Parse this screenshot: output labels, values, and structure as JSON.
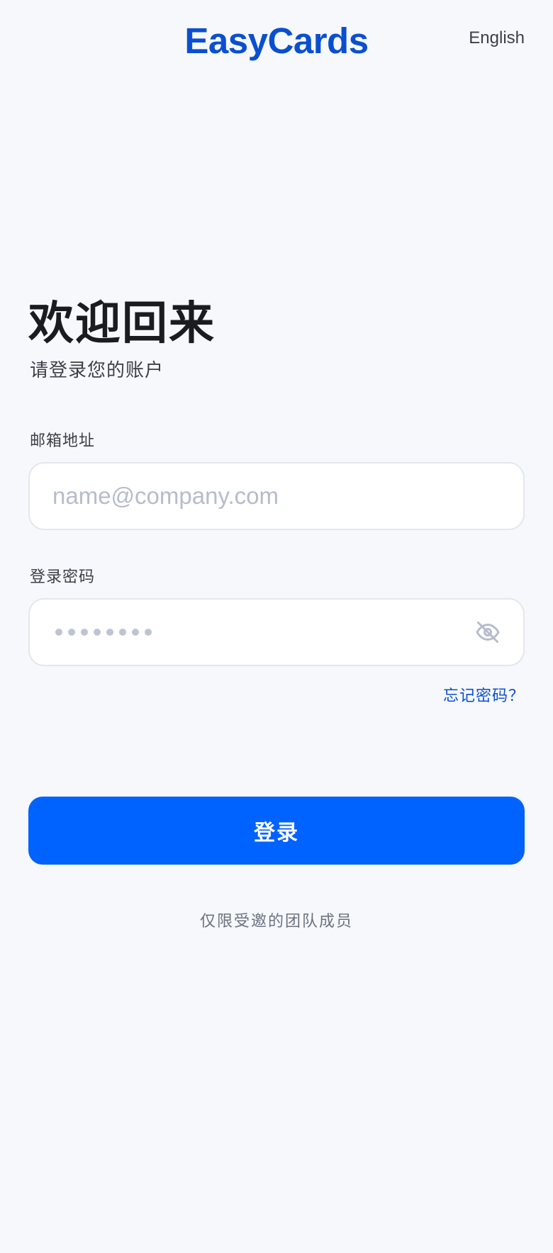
{
  "header": {
    "brand": "EasyCards",
    "language_link": "English"
  },
  "intro": {
    "title": "欢迎回来",
    "subtitle": "请登录您的账户"
  },
  "form": {
    "email": {
      "label": "邮箱地址",
      "placeholder": "name@company.com",
      "value": ""
    },
    "password": {
      "label": "登录密码",
      "masked_dots": 8,
      "visibility_icon": "eye-off-icon"
    },
    "forgot_link": "忘记密码？",
    "submit_label": "登录"
  },
  "footer": {
    "note": "仅限受邀的团队成员"
  },
  "colors": {
    "background": "#f7f8fb",
    "brand": "#0a4fcf",
    "primary_button": "#0062ff",
    "link": "#0a4fcf",
    "input_border": "#e4e6ee",
    "placeholder": "#b6bccb"
  }
}
